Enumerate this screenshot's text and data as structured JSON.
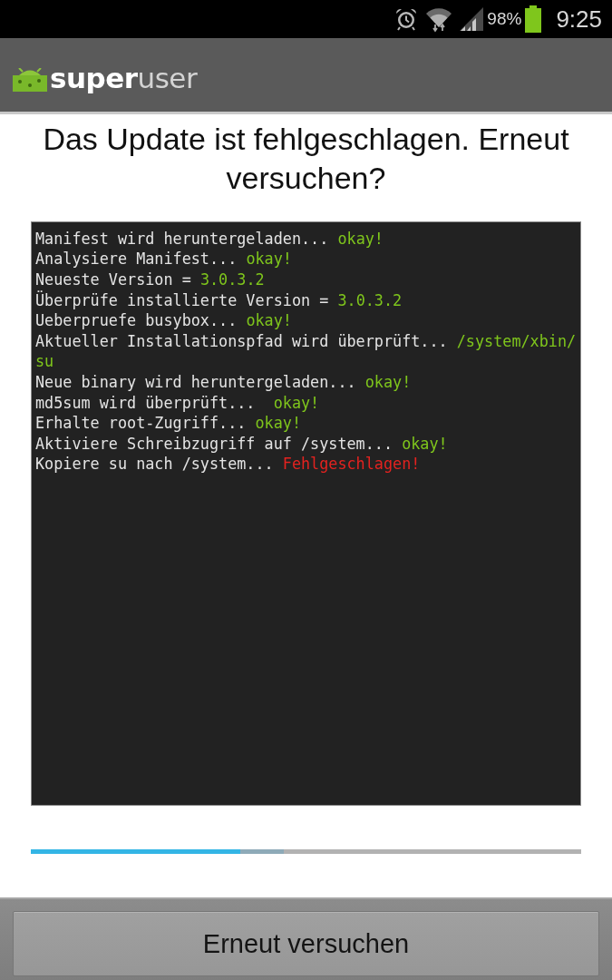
{
  "status_bar": {
    "battery": "98%",
    "time": "9:25"
  },
  "action_bar": {
    "logo": "**super**user"
  },
  "title": "Das Update ist fehlgeschlagen. Erneut versuchen?",
  "console": {
    "lines": [
      {
        "message": "Manifest wird heruntergeladen...",
        "result": "okay!",
        "kind": "success"
      },
      {
        "message": "Analysiere Manifest...",
        "result": "okay!",
        "kind": "success"
      },
      {
        "message": "Neueste Version =",
        "result": "3.0.3.2",
        "kind": "success"
      },
      {
        "message": "Überprüfe installierte Version =",
        "result": "3.0.3.2",
        "kind": "success"
      },
      {
        "message": "Ueberpruefe busybox...",
        "result": "okay!",
        "kind": "success"
      },
      {
        "message": "Aktueller Installationspfad wird überprüft...",
        "result": "/system/xbin/su",
        "kind": "success"
      },
      {
        "message": "Neue binary wird heruntergeladen...",
        "result": "okay!",
        "kind": "success"
      },
      {
        "message": "md5sum wird überprüft... ",
        "result": "okay!",
        "kind": "success"
      },
      {
        "message": "Erhalte root-Zugriff...",
        "result": "okay!",
        "kind": "success"
      },
      {
        "message": "Aktiviere Schreibzugriff auf /system...",
        "result": "okay!",
        "kind": "success"
      },
      {
        "message": "Kopiere su nach /system...",
        "result": "Fehlgeschlagen!",
        "kind": "error"
      }
    ]
  },
  "progress_bar": {
    "level": 0.38,
    "secondary": {
      "level": 0.46
    }
  },
  "buttons": [
    {
      "label": "Erneut versuchen"
    }
  ]
}
